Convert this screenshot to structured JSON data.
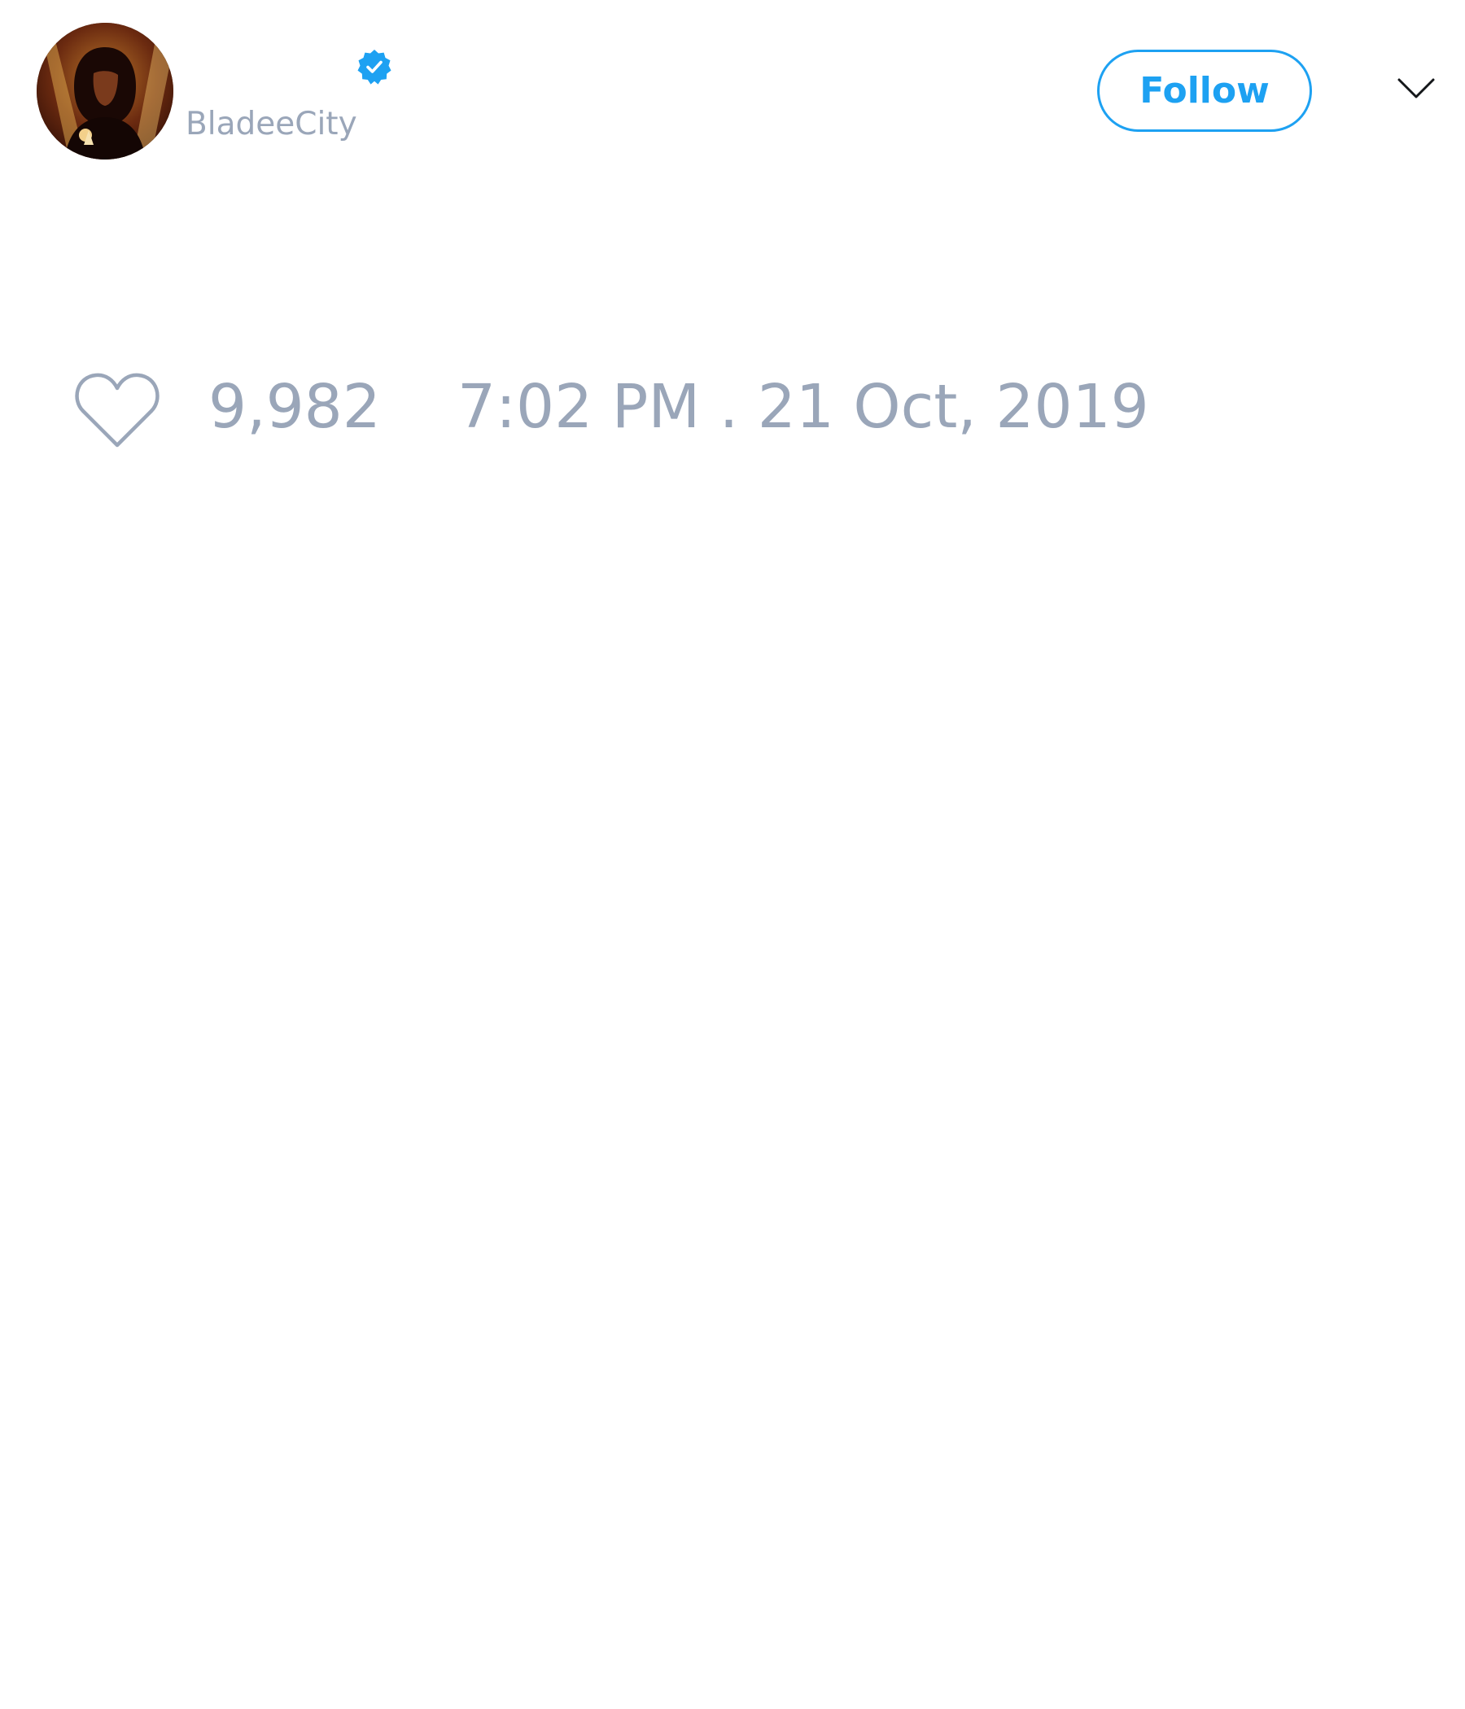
{
  "author": {
    "display_name": "",
    "handle": "BladeeCity",
    "verified": true,
    "avatar_icon": "avatar-photo"
  },
  "header": {
    "follow_label": "Follow",
    "menu_icon": "chevron-down-icon"
  },
  "actions": {
    "like_icon": "heart-icon",
    "like_count": "9,982",
    "timestamp": "7:02 PM . 21 Oct, 2019"
  },
  "colors": {
    "accent": "#1da1f2",
    "muted_text": "#9aa6b9",
    "background": "#ffffff"
  }
}
